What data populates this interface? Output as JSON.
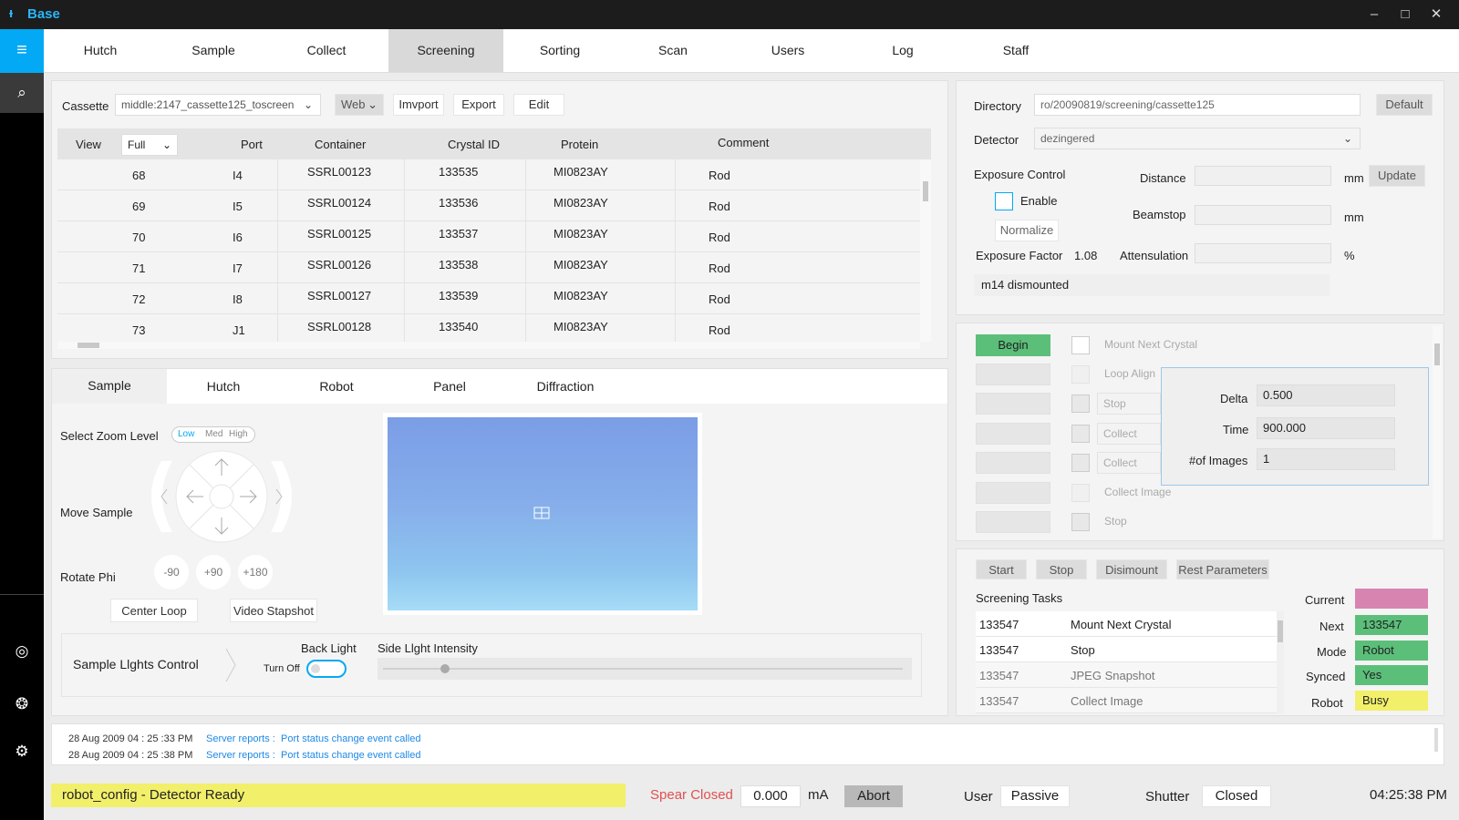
{
  "app": {
    "title": "Base"
  },
  "nav_tabs": [
    "Hutch",
    "Sample",
    "Collect",
    "Screening",
    "Sorting",
    "Scan",
    "Users",
    "Log",
    "Staff"
  ],
  "cassette": {
    "label": "Cassette",
    "value": "middle:2147_cassette125_toscreen",
    "source": "Web",
    "import_label": "Imvport",
    "export_label": "Export",
    "edit_label": "Edit"
  },
  "table": {
    "view_label": "View",
    "view_value": "Full",
    "headers": [
      "Port",
      "Container",
      "Crystal ID",
      "Protein",
      "Comment"
    ],
    "rows": [
      {
        "num": "68",
        "port": "I4",
        "container": "SSRL00123",
        "crystal": "133535",
        "protein": "MI0823AY",
        "comment": "Rod"
      },
      {
        "num": "69",
        "port": "I5",
        "container": "SSRL00124",
        "crystal": "133536",
        "protein": "MI0823AY",
        "comment": "Rod"
      },
      {
        "num": "70",
        "port": "I6",
        "container": "SSRL00125",
        "crystal": "133537",
        "protein": "MI0823AY",
        "comment": "Rod"
      },
      {
        "num": "71",
        "port": "I7",
        "container": "SSRL00126",
        "crystal": "133538",
        "protein": "MI0823AY",
        "comment": "Rod"
      },
      {
        "num": "72",
        "port": "I8",
        "container": "SSRL00127",
        "crystal": "133539",
        "protein": "MI0823AY",
        "comment": "Rod"
      },
      {
        "num": "73",
        "port": "J1",
        "container": "SSRL00128",
        "crystal": "133540",
        "protein": "MI0823AY",
        "comment": "Rod"
      }
    ]
  },
  "sub_tabs": [
    "Sample",
    "Hutch",
    "Robot",
    "Panel",
    "Diffraction"
  ],
  "sample": {
    "zoom_label": "Select Zoom Level",
    "zoom_options": [
      "Low",
      "Med",
      "High"
    ],
    "move_label": "Move Sample",
    "rotate_label": "Rotate Phi",
    "rotate_buttons": [
      "-90",
      "+90",
      "+180"
    ],
    "center_loop": "Center Loop",
    "video_snapshot": "Video Stapshot",
    "lights_label": "Sample Llghts Control",
    "back_light": "Back Light",
    "turn_off": "Turn Off",
    "side_light": "Side Llght Intensity",
    "side_light_level": 0.12
  },
  "settings": {
    "directory_label": "Directory",
    "directory_value": "ro/20090819/screening/cassette125",
    "default_label": "Default",
    "detector_label": "Detector",
    "detector_value": "dezingered",
    "exposure_control": "Exposure Control",
    "enable": "Enable",
    "normalize": "Normalize",
    "exposure_factor_label": "Exposure Factor",
    "exposure_factor_value": "1.08",
    "distance_label": "Distance",
    "beamstop_label": "Beamstop",
    "attenuation_label": "Attensulation",
    "unit_mm": "mm",
    "unit_pct": "%",
    "update_label": "Update",
    "status_msg": "m14 dismounted"
  },
  "sequence": {
    "begin": "Begin",
    "steps": [
      "Mount Next Crystal",
      "Loop Align",
      "Stop",
      "Collect",
      "Collect",
      "Collect Image",
      "Stop"
    ],
    "popup": {
      "delta_label": "Delta",
      "delta_value": "0.500",
      "time_label": "Time",
      "time_value": "900.000",
      "images_label": "#of Images",
      "images_value": "1"
    }
  },
  "tasks": {
    "buttons": [
      "Start",
      "Stop",
      "Disimount",
      "Rest Parameters"
    ],
    "title": "Screening Tasks",
    "rows": [
      {
        "id": "133547",
        "name": "Mount Next Crystal"
      },
      {
        "id": "133547",
        "name": "Stop"
      },
      {
        "id": "133547",
        "name": "JPEG Snapshot"
      },
      {
        "id": "133547",
        "name": "Collect Image"
      }
    ],
    "status": {
      "current_label": "Current",
      "current_value": "",
      "next_label": "Next",
      "next_value": "133547",
      "mode_label": "Mode",
      "mode_value": "Robot",
      "synced_label": "Synced",
      "synced_value": "Yes",
      "robot_label": "Robot",
      "robot_value": "Busy"
    }
  },
  "log": [
    {
      "time": "28 Aug 2009 04 : 25 :33 PM",
      "source": "Server reports :",
      "message": "Port status change event called"
    },
    {
      "time": "28 Aug 2009 04 : 25 :38 PM",
      "source": "Server reports :",
      "message": "Port status change event called"
    }
  ],
  "statusbar": {
    "message": "robot_config - Detector Ready",
    "spear": "Spear Closed",
    "current_value": "0.000",
    "current_unit": "mA",
    "abort": "Abort",
    "user_label": "User",
    "user_value": "Passive",
    "shutter_label": "Shutter",
    "shutter_value": "Closed",
    "clock": "04:25:38 PM"
  },
  "colors": {
    "accent": "#03a9f4",
    "green": "#5bbf7a",
    "yellow": "#f2ef6b",
    "pink": "#d884b0",
    "spear_red": "#e05050"
  }
}
